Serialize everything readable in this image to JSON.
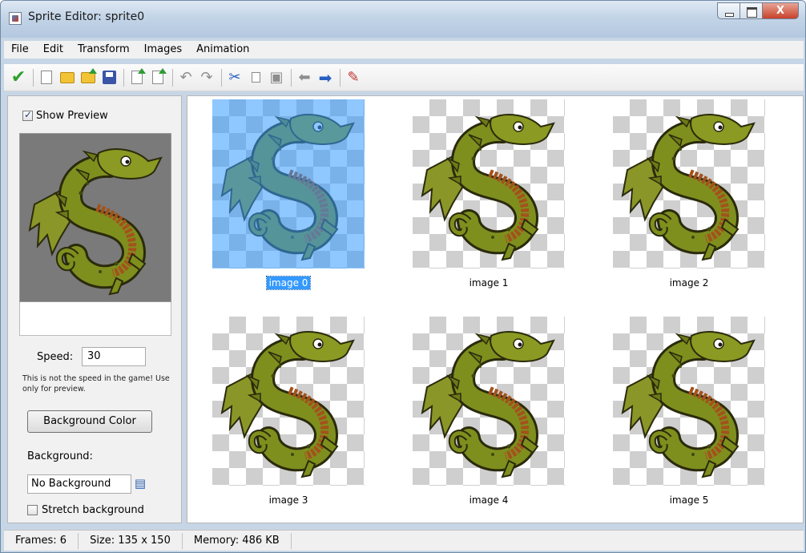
{
  "window": {
    "title": "Sprite Editor: sprite0",
    "close_label": "X"
  },
  "menu": [
    "File",
    "Edit",
    "Transform",
    "Images",
    "Animation"
  ],
  "toolbar": {
    "groups": [
      [
        "ok-icon"
      ],
      [
        "new-icon",
        "open-icon",
        "open-add-icon",
        "save-icon"
      ],
      [
        "import-icon",
        "export-icon"
      ],
      [
        "undo-icon",
        "redo-icon"
      ],
      [
        "cut-icon",
        "copy-icon",
        "paste-icon"
      ],
      [
        "move-left-icon",
        "move-right-icon"
      ],
      [
        "edit-pencil-icon"
      ]
    ]
  },
  "left_panel": {
    "show_preview_label": "Show Preview",
    "show_preview_checked": true,
    "speed_label": "Speed:",
    "speed_value": "30",
    "speed_note": "This is not the speed in the game! Use only for preview.",
    "bg_color_button": "Background Color",
    "background_label": "Background:",
    "background_value": "No Background",
    "stretch_label": "Stretch background",
    "stretch_checked": false
  },
  "images": [
    {
      "label": "image 0",
      "selected": true
    },
    {
      "label": "image 1",
      "selected": false
    },
    {
      "label": "image 2",
      "selected": false
    },
    {
      "label": "image 3",
      "selected": false
    },
    {
      "label": "image 4",
      "selected": false
    },
    {
      "label": "image 5",
      "selected": false
    }
  ],
  "status": {
    "frames": "Frames: 6",
    "size": "Size: 135 x 150",
    "memory": "Memory: 486 KB"
  },
  "colors": {
    "selection": "#3399ff",
    "dragon_body": "#7f8f1e",
    "dragon_belly": "#a3521c"
  }
}
